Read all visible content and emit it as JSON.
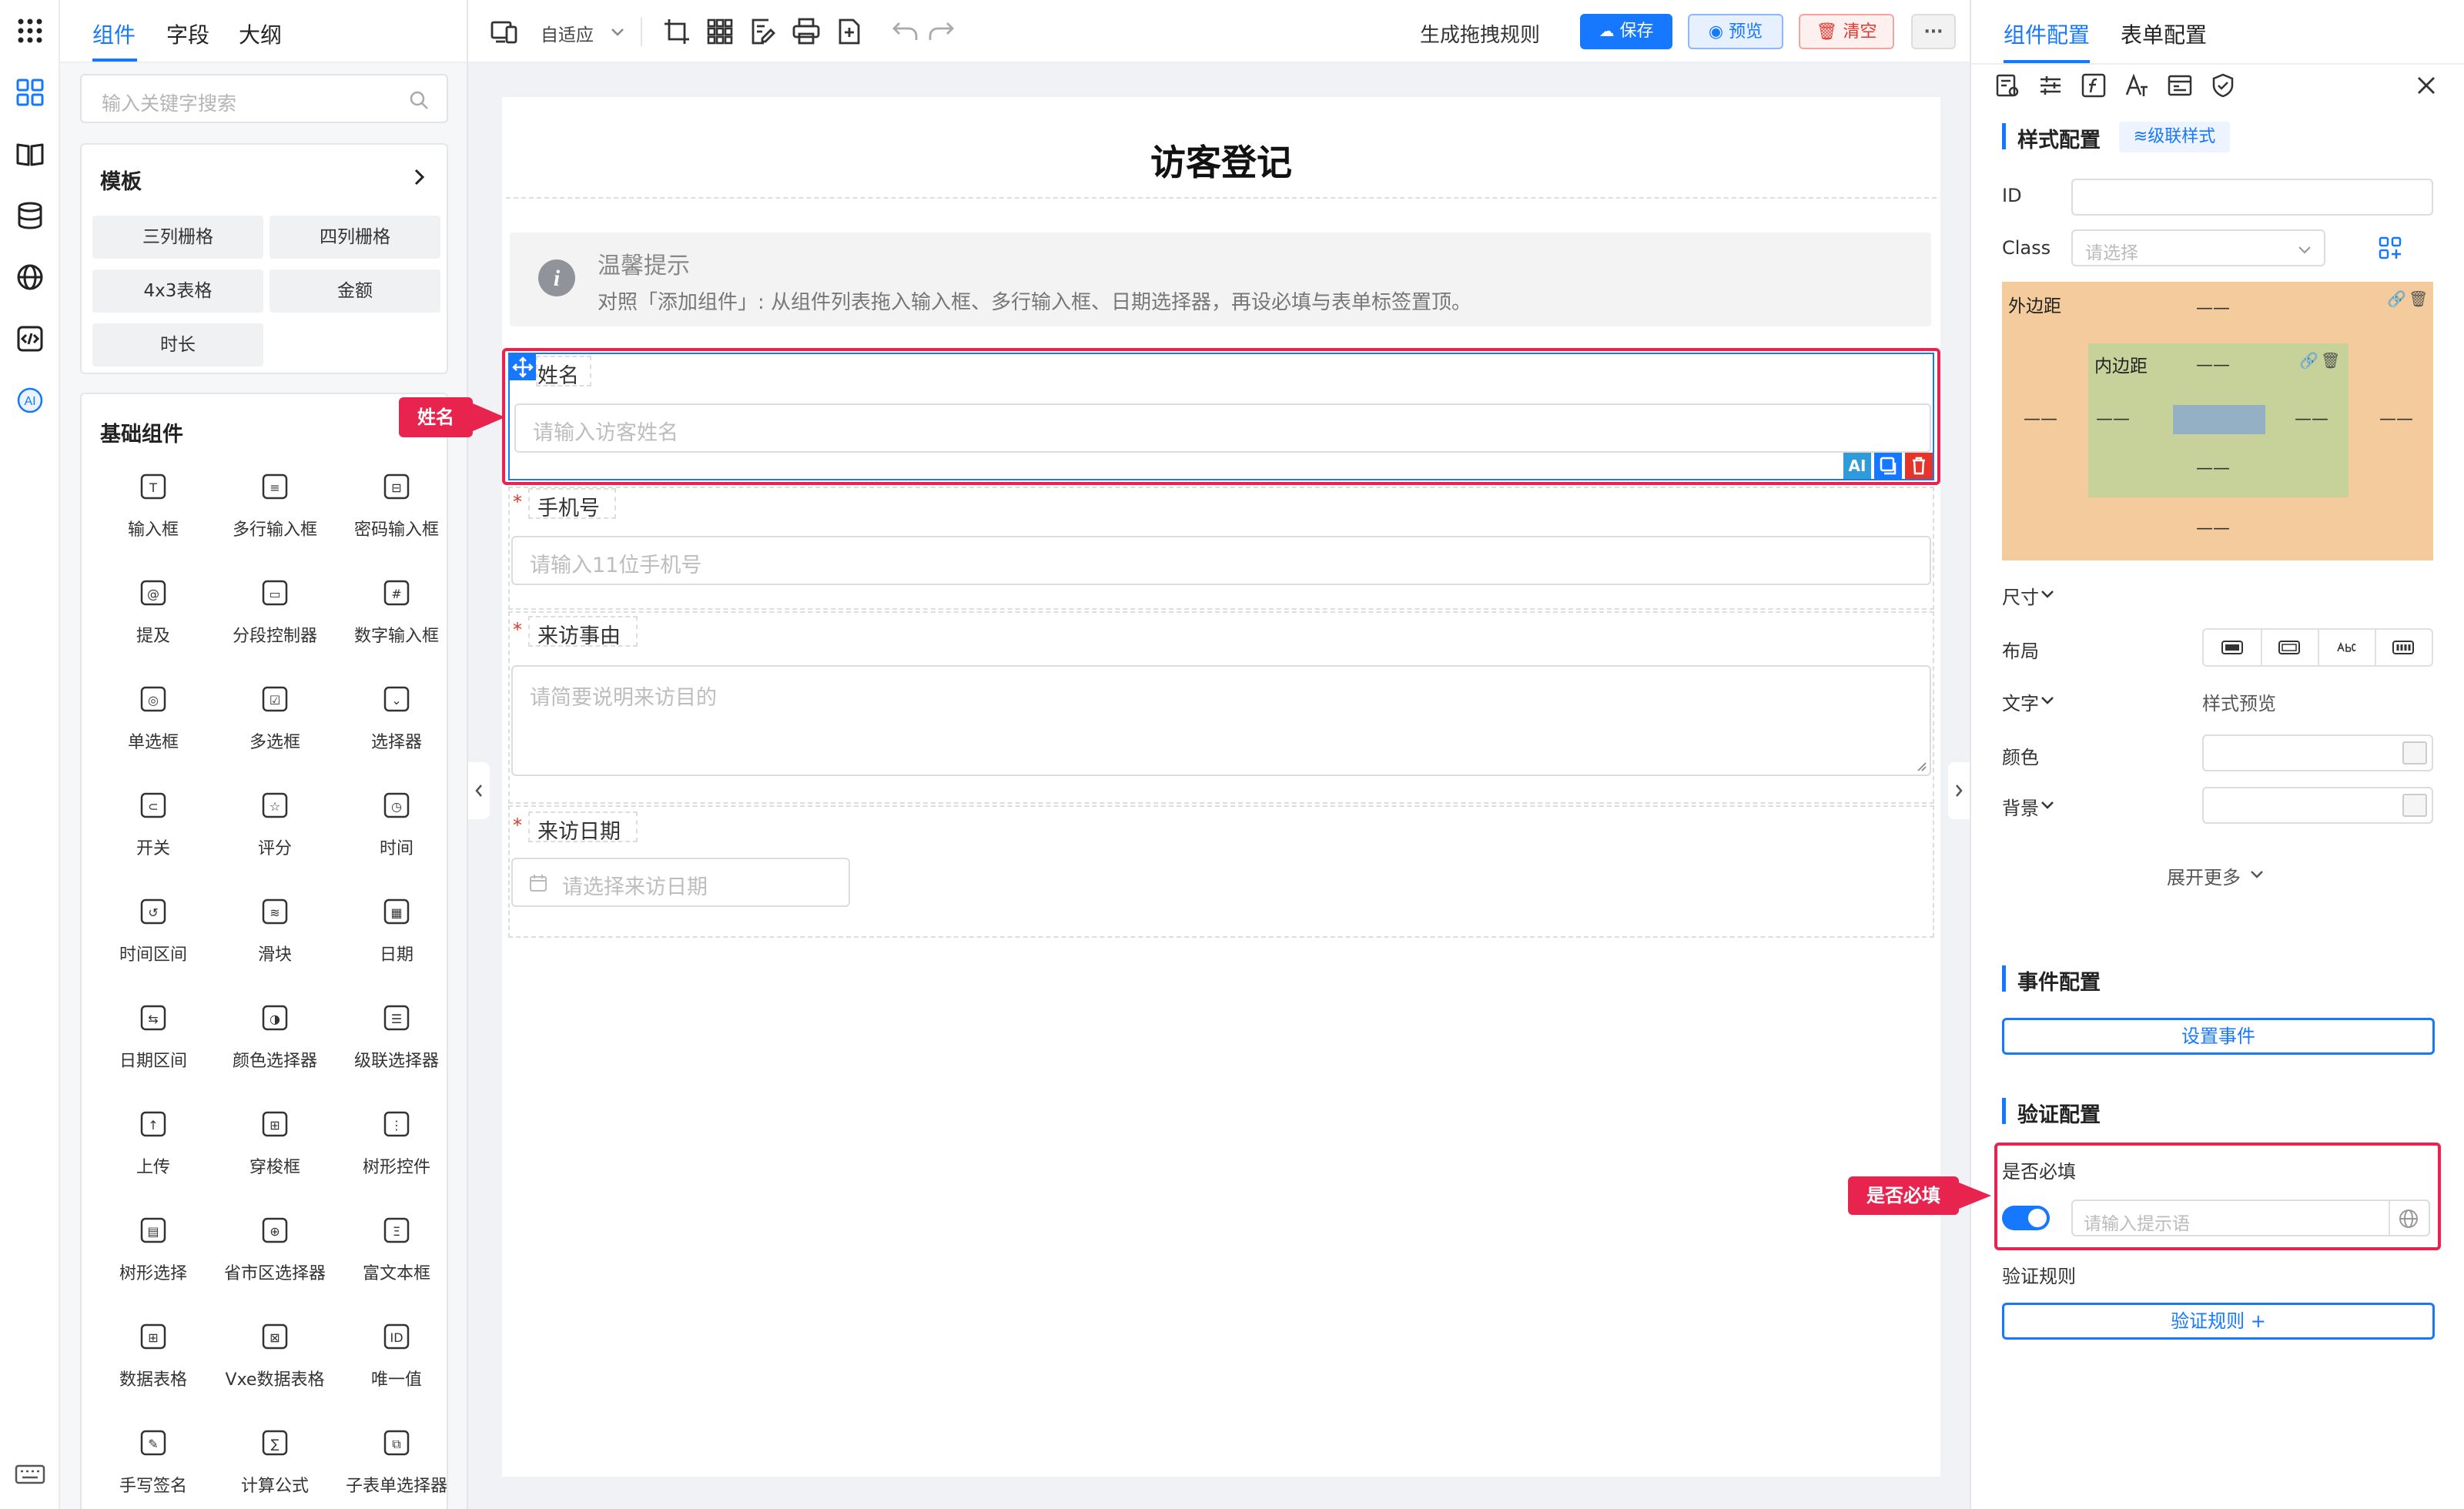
{
  "left_panel": {
    "tabs": [
      "组件",
      "字段",
      "大纲"
    ],
    "search_placeholder": "输入关键字搜索",
    "template_title": "模板",
    "templates": [
      "三列栅格",
      "四列栅格",
      "4x3表格",
      "金额",
      "时长"
    ],
    "basic_title": "基础组件",
    "components": [
      "输入框",
      "多行输入框",
      "密码输入框",
      "提及",
      "分段控制器",
      "数字输入框",
      "单选框",
      "多选框",
      "选择器",
      "开关",
      "评分",
      "时间",
      "时间区间",
      "滑块",
      "日期",
      "日期区间",
      "颜色选择器",
      "级联选择器",
      "上传",
      "穿梭框",
      "树形控件",
      "树形选择",
      "省市区选择器",
      "富文本框",
      "数据表格",
      "Vxe数据表格",
      "唯一值",
      "手写签名",
      "计算公式",
      "子表单选择器"
    ]
  },
  "toolbar": {
    "adaptive": "自适应",
    "gen_rule": "生成拖拽规则",
    "save": "保存",
    "preview": "预览",
    "clear": "清空",
    "more": "···"
  },
  "form": {
    "title": "访客登记",
    "tip_title": "温馨提示",
    "tip_text": "对照「添加组件」: 从组件列表拖入输入框、多行输入框、日期选择器，再设必填与表单标签置顶。",
    "fields": [
      {
        "label": "姓名",
        "placeholder": "请输入访客姓名",
        "required": false
      },
      {
        "label": "手机号",
        "placeholder": "请输入11位手机号",
        "required": true
      },
      {
        "label": "来访事由",
        "placeholder": "请简要说明来访目的",
        "required": true
      },
      {
        "label": "来访日期",
        "placeholder": "请选择来访日期",
        "required": true
      }
    ],
    "field_tools": [
      "AI"
    ]
  },
  "right_panel": {
    "tabs": [
      "组件配置",
      "表单配置"
    ],
    "style_config": "样式配置",
    "cascade_style": "级联样式",
    "id_label": "ID",
    "class_label": "Class",
    "class_placeholder": "请选择",
    "margin_label": "外边距",
    "padding_label": "内边距",
    "box_dash": "——",
    "size_label": "尺寸",
    "layout_label": "布局",
    "text_label": "文字",
    "style_preview": "样式预览",
    "color_label": "颜色",
    "bg_label": "背景",
    "expand_more": "展开更多",
    "event_config": "事件配置",
    "set_event": "设置事件",
    "validate_config": "验证配置",
    "required_label": "是否必填",
    "required_placeholder": "请输入提示语",
    "rules_label": "验证规则",
    "rules_btn": "验证规则 +"
  },
  "callouts": {
    "name": "姓名",
    "required": "是否必填"
  },
  "colors": {
    "accent": "#1677ff",
    "danger": "#e5352a",
    "callout": "#e8244e",
    "margin_bg": "#f3cb9c",
    "padding_bg": "#c6d29a",
    "content_bg": "#93b0c4"
  }
}
